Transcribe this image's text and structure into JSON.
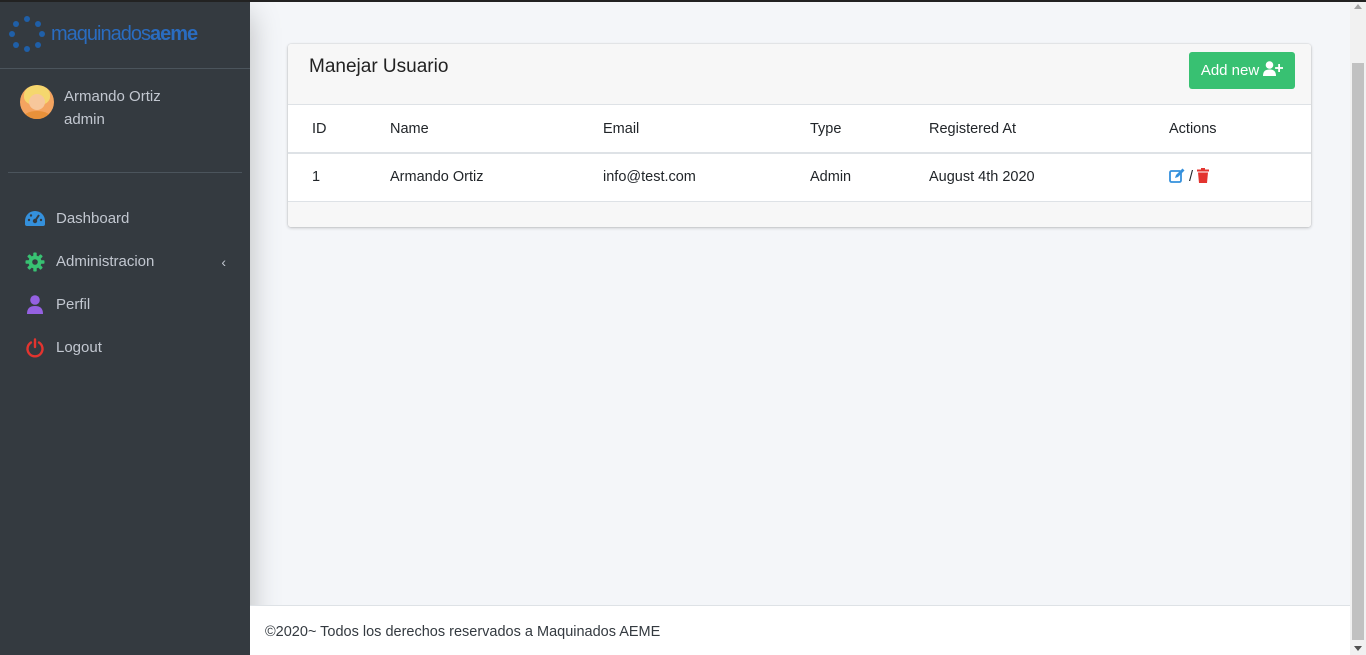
{
  "brand": {
    "name_light": "maquinados",
    "name_bold": "aeme"
  },
  "user": {
    "name": "Armando Ortiz",
    "role": "admin"
  },
  "nav": {
    "items": [
      {
        "label": "Dashboard",
        "icon": "tachometer-icon",
        "color": "#3490dc"
      },
      {
        "label": "Administracion",
        "icon": "gear-icon",
        "color": "#38c172"
      },
      {
        "label": "Perfil",
        "icon": "user-icon",
        "color": "#9561e2"
      },
      {
        "label": "Logout",
        "icon": "power-icon",
        "color": "#e3342f"
      }
    ],
    "chevron": "‹"
  },
  "card": {
    "title": "Manejar Usuario",
    "add_button": "Add new",
    "columns": [
      "ID",
      "Name",
      "Email",
      "Type",
      "Registered At",
      "Actions"
    ],
    "rows": [
      {
        "id": "1",
        "name": "Armando Ortiz",
        "email": "info@test.com",
        "type": "Admin",
        "registered": "August 4th 2020",
        "actions_sep": "/"
      }
    ]
  },
  "footer": {
    "text": "©2020~ Todos los derechos reservados a Maquinados AEME"
  },
  "colors": {
    "sidebar": "#343a40",
    "success": "#38c172",
    "edit": "#3490dc",
    "delete": "#e3342f"
  }
}
